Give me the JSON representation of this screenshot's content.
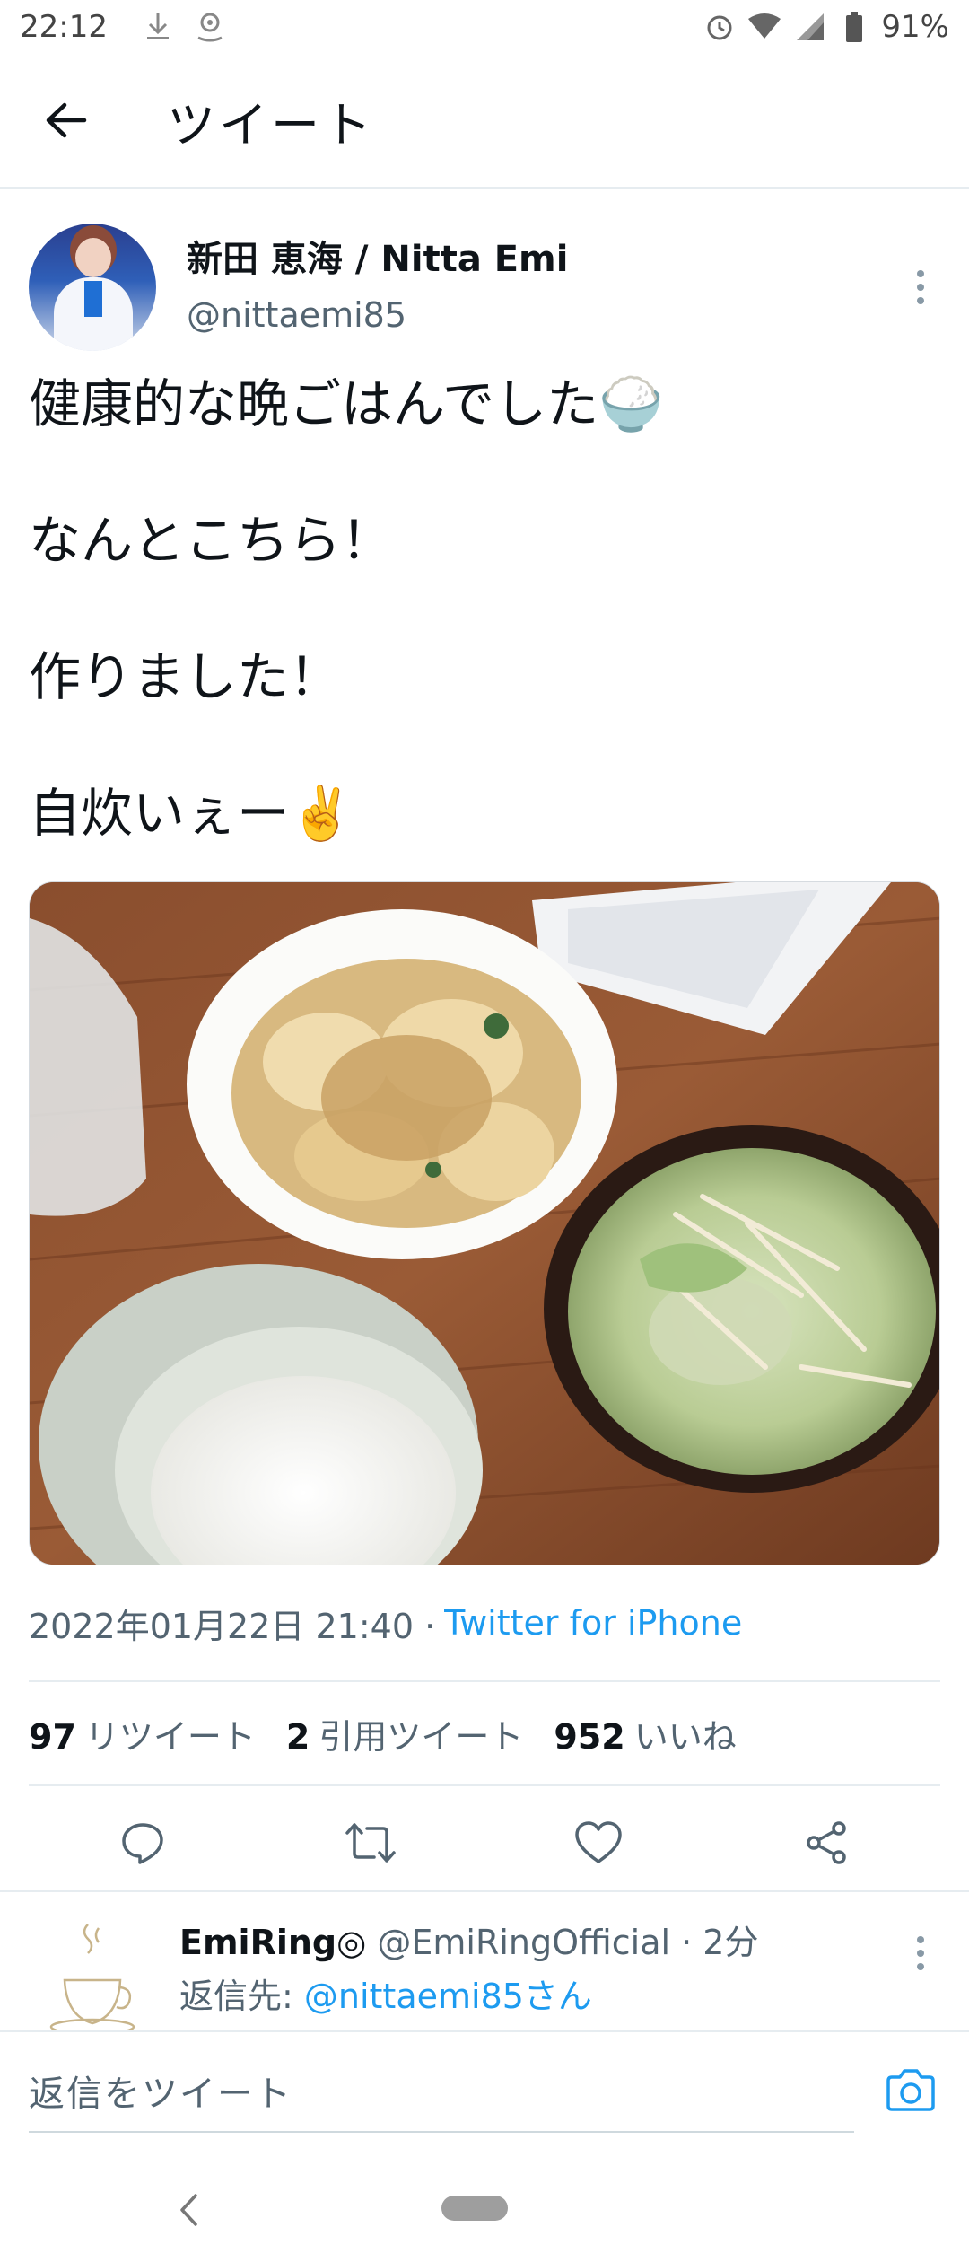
{
  "status_bar": {
    "time": "22:12",
    "battery": "91%",
    "icons": [
      "download-icon",
      "location-icon",
      "alarm-icon",
      "wifi-icon",
      "signal-icon",
      "battery-icon"
    ]
  },
  "header": {
    "title": "ツイート",
    "back_icon": "arrow-left-icon"
  },
  "tweet": {
    "author_name": "新田 恵海 / Nitta Emi",
    "author_handle": "@nittaemi85",
    "text_lines": [
      "健康的な晩ごはんでした🍚",
      "なんとこちら！",
      "作りました！",
      "自炊いぇー✌️"
    ],
    "timestamp": "2022年01月22日 21:40 · ",
    "source": "Twitter for iPhone",
    "stats": {
      "retweets_count": "97",
      "retweets_label": "リツイート",
      "quotes_count": "2",
      "quotes_label": "引用ツイート",
      "likes_count": "952",
      "likes_label": "いいね"
    },
    "actions": [
      "reply-icon",
      "retweet-icon",
      "like-icon",
      "share-icon"
    ]
  },
  "reply": {
    "name": "EmiRing◎",
    "handle_time": " @EmiRingOfficial · 2分",
    "reply_to_label": "返信先: ",
    "reply_to_mention": "@nittaemi85さん"
  },
  "compose": {
    "placeholder": "返信をツイート",
    "icon": "camera-icon"
  },
  "colors": {
    "accent": "#1d9bf0",
    "text": "#0f1419",
    "muted": "#536471",
    "divider": "#e6ecf0"
  }
}
